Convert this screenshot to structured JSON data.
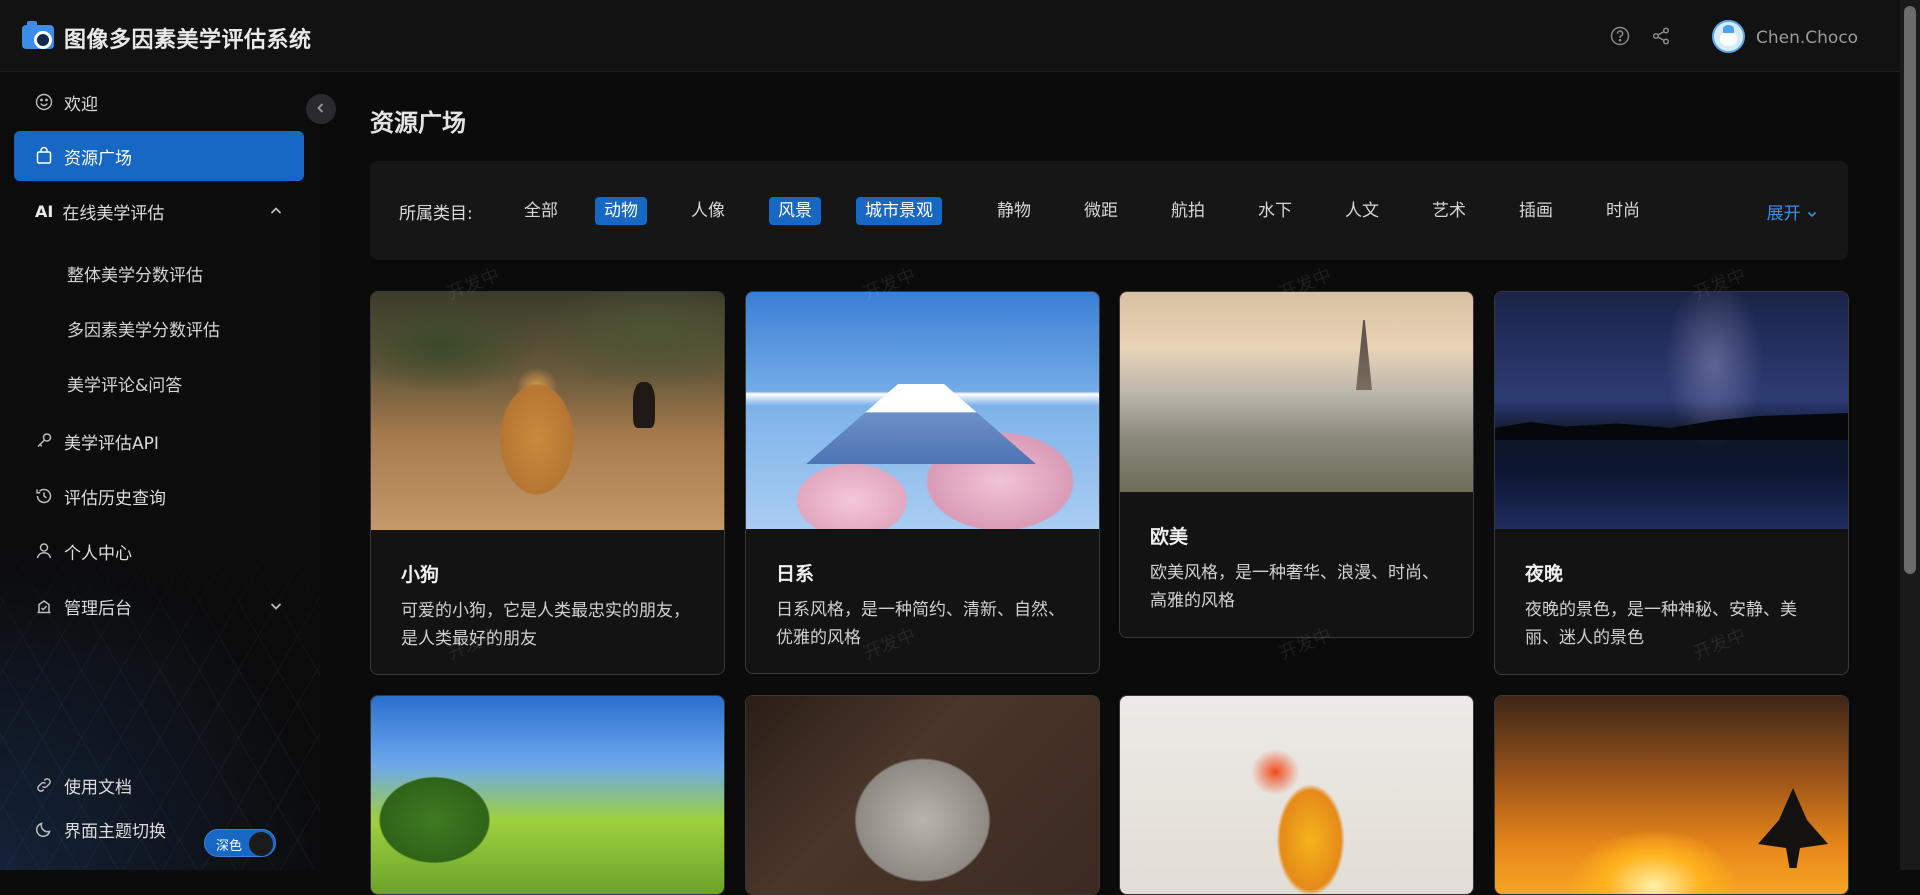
{
  "app": {
    "title": "图像多因素美学评估系统",
    "user": "Chen.Choco"
  },
  "header": {
    "icons": [
      "help-icon",
      "share-icon"
    ]
  },
  "sidebar": {
    "items": [
      {
        "label": "欢迎",
        "icon": "smile-icon"
      },
      {
        "label": "资源广场",
        "icon": "bag-icon",
        "active": true
      },
      {
        "badge": "AI",
        "label": "在线美学评估",
        "expanded": true
      },
      {
        "label": "美学评估API",
        "icon": "key-icon"
      },
      {
        "label": "评估历史查询",
        "icon": "history-icon"
      },
      {
        "label": "个人中心",
        "icon": "user-icon"
      },
      {
        "label": "管理后台",
        "icon": "admin-icon",
        "expanded": false
      }
    ],
    "sub_items": [
      "整体美学分数评估",
      "多因素美学分数评估",
      "美学评论&问答"
    ],
    "bottom": {
      "docs": "使用文档",
      "theme": "界面主题切换",
      "theme_value": "深色"
    }
  },
  "main": {
    "title": "资源广场",
    "filter": {
      "label": "所属类目:",
      "categories": [
        {
          "label": "全部",
          "selected": false
        },
        {
          "label": "动物",
          "selected": true
        },
        {
          "label": "人像",
          "selected": false
        },
        {
          "label": "风景",
          "selected": true
        },
        {
          "label": "城市景观",
          "selected": true
        },
        {
          "label": "静物",
          "selected": false
        },
        {
          "label": "微距",
          "selected": false
        },
        {
          "label": "航拍",
          "selected": false
        },
        {
          "label": "水下",
          "selected": false
        },
        {
          "label": "人文",
          "selected": false
        },
        {
          "label": "艺术",
          "selected": false
        },
        {
          "label": "插画",
          "selected": false
        },
        {
          "label": "时尚",
          "selected": false
        }
      ],
      "expand": "展开"
    },
    "watermark": "开发中",
    "cards": [
      {
        "title": "小狗",
        "desc": "可爱的小狗，它是人类最忠实的朋友，是人类最好的朋友"
      },
      {
        "title": "日系",
        "desc": "日系风格，是一种简约、清新、自然、优雅的风格"
      },
      {
        "title": "欧美",
        "desc": "欧美风格，是一种奢华、浪漫、时尚、高雅的风格"
      },
      {
        "title": "夜晚",
        "desc": "夜晚的景色，是一种神秘、安静、美丽、迷人的景色"
      }
    ]
  },
  "colors": {
    "accent": "#1668c4",
    "link": "#3d8fe6",
    "background": "#0b0b0c",
    "panel": "#161617"
  }
}
